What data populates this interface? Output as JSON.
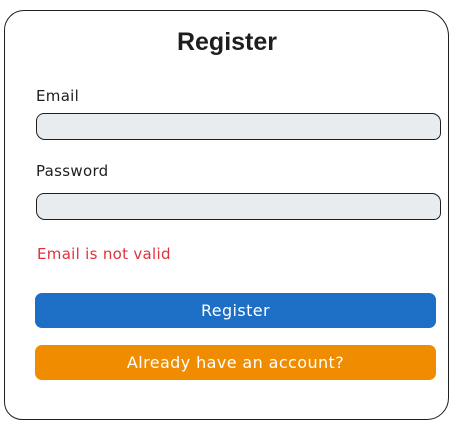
{
  "form": {
    "title": "Register",
    "email_label": "Email",
    "email_value": "",
    "password_label": "Password",
    "password_value": "",
    "error_message": "Email is not valid",
    "register_button_label": "Register",
    "login_link_label": "Already have an account?"
  },
  "colors": {
    "primary_button": "#1c6fc5",
    "secondary_button": "#f08c00",
    "error_text": "#e0323c",
    "input_background": "#e8ecef"
  }
}
